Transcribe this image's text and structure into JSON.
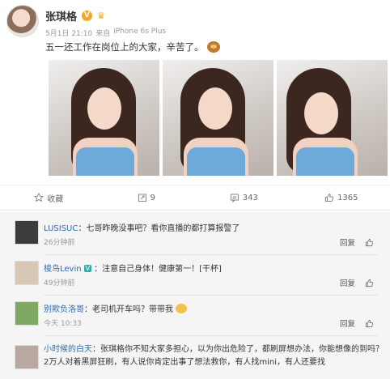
{
  "post": {
    "author": "张琪格",
    "date": "5月1日 21:10",
    "source_prefix": "来自",
    "source": "iPhone 6s Plus",
    "text": "五一还工作在岗位上的大家，辛苦了。"
  },
  "actions": {
    "favorite": "收藏",
    "repost_count": "9",
    "comment_count": "343",
    "like_count": "1365"
  },
  "comments": [
    {
      "user": "LUSISUC",
      "text": "：七哥昨晚没事吧？看你直播的都打算报警了",
      "time": "26分钟前",
      "reply": "回复"
    },
    {
      "user": "梭鸟Levin",
      "badge": "V",
      "text": "：注意自己身体！健康第一！[干杯]",
      "time": "49分钟前",
      "reply": "回复"
    },
    {
      "user": "别欺负洛哥",
      "text": "：老司机开车吗？带带我",
      "time": "今天 10:33",
      "reply": "回复"
    },
    {
      "user": "小时候的白天",
      "text": "：张琪格你不知大家多担心，以为你出危险了，都刷屏想办法，你能想像的到吗？2万人对着黑屏狂刷，有人说你肯定出事了想法救你，有人找mini，有人还要找"
    }
  ],
  "colors": {
    "link": "#2a6ab3",
    "badge": "#f6a623",
    "comment_bg": "#f5f5f5"
  },
  "icons": {
    "favorite": "star-icon",
    "repost": "repost-icon",
    "comment": "comment-icon",
    "like": "thumb-up-icon"
  }
}
